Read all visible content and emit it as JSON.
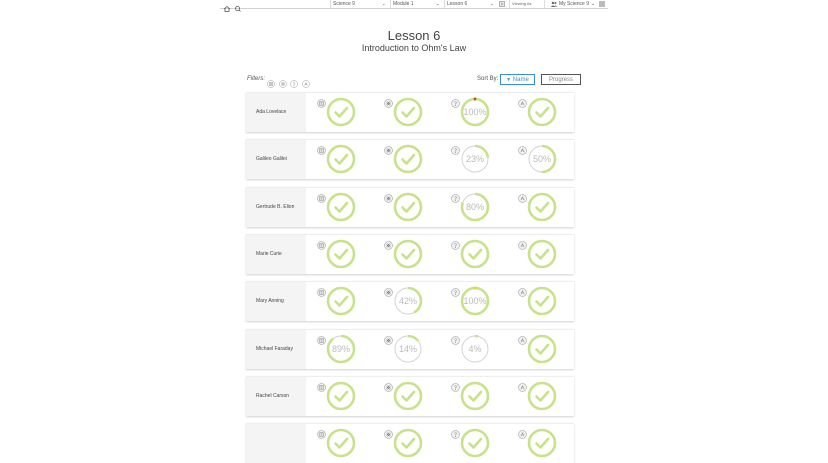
{
  "topbar": {
    "class_select": "Science 9",
    "module_select": "Module 1",
    "lesson_select": "Lesson 6",
    "viewing_as": "Viewing As",
    "class_name": "My Science 9"
  },
  "page": {
    "title": "Lesson 6",
    "subtitle": "Introduction to Ohm's Law"
  },
  "filters": {
    "label": "Filters:",
    "icons": [
      "lesson-filter-icon",
      "activity-filter-icon",
      "question-filter-icon",
      "assessment-filter-icon"
    ]
  },
  "sort": {
    "label": "Sort By:",
    "name_label": "Name",
    "progress_label": "Progress",
    "active": "Name"
  },
  "colors": {
    "complete": "#c7e28a",
    "partial": "#c7e28a",
    "track": "#cfcfcf",
    "alert_red": "#d9402b",
    "alert_yellow": "#f0d43a",
    "accent_blue": "#3b8fd9"
  },
  "activity_types": [
    "lesson",
    "activity",
    "question",
    "assessment"
  ],
  "students": [
    {
      "name": "Ada Lovelace",
      "progress": [
        100,
        100,
        100,
        100
      ],
      "display": [
        "",
        "",
        "100%",
        ""
      ],
      "alert": [
        "",
        "",
        "red",
        ""
      ]
    },
    {
      "name": "Galileo Galilei",
      "progress": [
        100,
        100,
        23,
        50
      ],
      "display": [
        "",
        "",
        "23%",
        "50%"
      ],
      "alert": [
        "",
        "",
        "",
        ""
      ]
    },
    {
      "name": "Gertrude B. Elion",
      "progress": [
        100,
        100,
        80,
        100
      ],
      "display": [
        "",
        "",
        "80%",
        ""
      ],
      "alert": [
        "",
        "",
        "",
        ""
      ]
    },
    {
      "name": "Marie Curie",
      "progress": [
        100,
        100,
        100,
        100
      ],
      "display": [
        "",
        "",
        "",
        ""
      ],
      "alert": [
        "",
        "",
        "",
        ""
      ]
    },
    {
      "name": "Mary Anning",
      "progress": [
        100,
        42,
        100,
        100
      ],
      "display": [
        "",
        "42%",
        "100%",
        ""
      ],
      "alert": [
        "",
        "",
        "yellow",
        ""
      ]
    },
    {
      "name": "Michael Faraday",
      "progress": [
        89,
        14,
        4,
        100
      ],
      "display": [
        "89%",
        "14%",
        "4%",
        ""
      ],
      "alert": [
        "",
        "",
        "",
        ""
      ]
    },
    {
      "name": "Rachel Carson",
      "progress": [
        100,
        100,
        100,
        100
      ],
      "display": [
        "",
        "",
        "",
        ""
      ],
      "alert": [
        "",
        "",
        "",
        ""
      ]
    },
    {
      "name": "",
      "progress": [
        100,
        100,
        100,
        100
      ],
      "display": [
        "",
        "",
        "",
        ""
      ],
      "alert": [
        "",
        "",
        "",
        ""
      ]
    }
  ]
}
